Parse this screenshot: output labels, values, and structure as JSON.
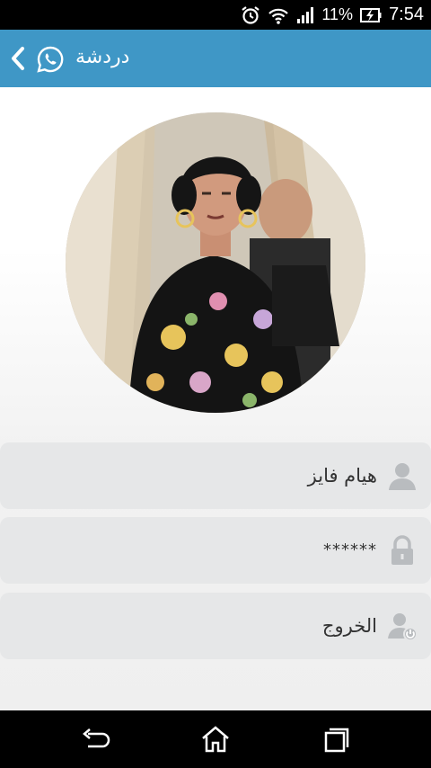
{
  "status_bar": {
    "battery": "11%",
    "time": "7:54"
  },
  "app_bar": {
    "title": "دردشة",
    "icons": [
      "back-chevron-icon",
      "whatsapp-icon"
    ]
  },
  "profile": {
    "name": "هيام فايز",
    "password": "******",
    "logout_label": "الخروج"
  },
  "nav_bar": {
    "icons": [
      "back-icon",
      "home-icon",
      "recent-apps-icon"
    ]
  },
  "colors": {
    "app_bar": "#3f97c6",
    "row_bg": "#e6e7e8",
    "status_bar": "#000000"
  }
}
